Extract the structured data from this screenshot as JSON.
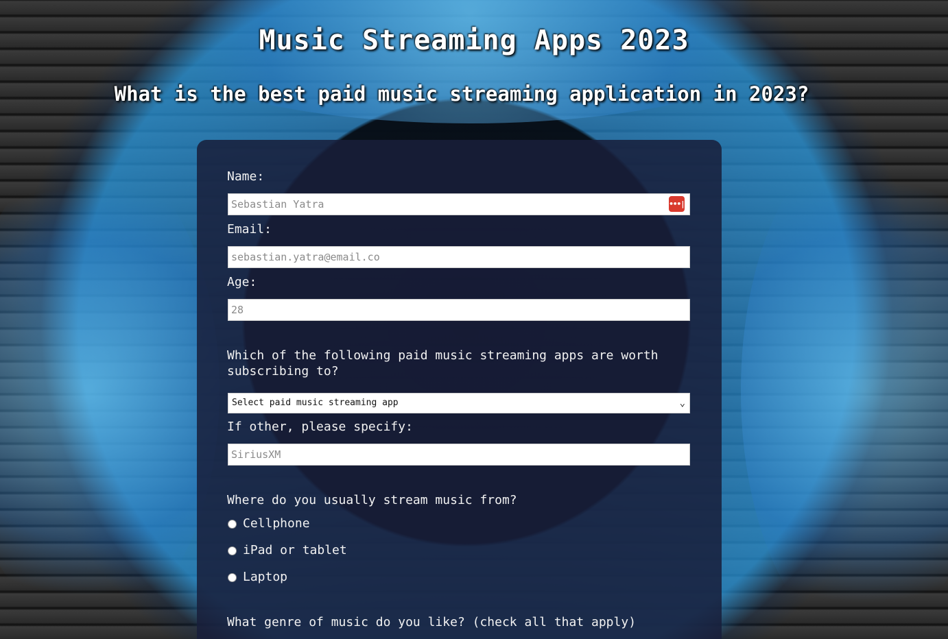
{
  "header": {
    "title": "Music Streaming Apps 2023",
    "subtitle": "What is the best paid music streaming application in 2023?"
  },
  "form": {
    "name_label": "Name:",
    "name_placeholder": "Sebastian Yatra",
    "email_label": "Email:",
    "email_placeholder": "sebastian.yatra@email.co",
    "age_label": "Age:",
    "age_placeholder": "28",
    "app_question": "Which of the following paid music streaming apps are worth subscribing to?",
    "app_select_value": "Select paid music streaming app",
    "other_label": "If other, please specify:",
    "other_placeholder": "SiriusXM",
    "device_question": "Where do you usually stream music from?",
    "device_options": [
      "Cellphone",
      "iPad or tablet",
      "Laptop"
    ],
    "genre_question": "What genre of music do you like? (check all that apply)"
  },
  "icons": {
    "password_manager": "password-manager-icon",
    "select_arrow": "chevron-down-icon"
  },
  "colors": {
    "card_background": "#181e3a",
    "password_icon_bg": "#d93a2e",
    "ring_accent": "#28a0e0"
  }
}
